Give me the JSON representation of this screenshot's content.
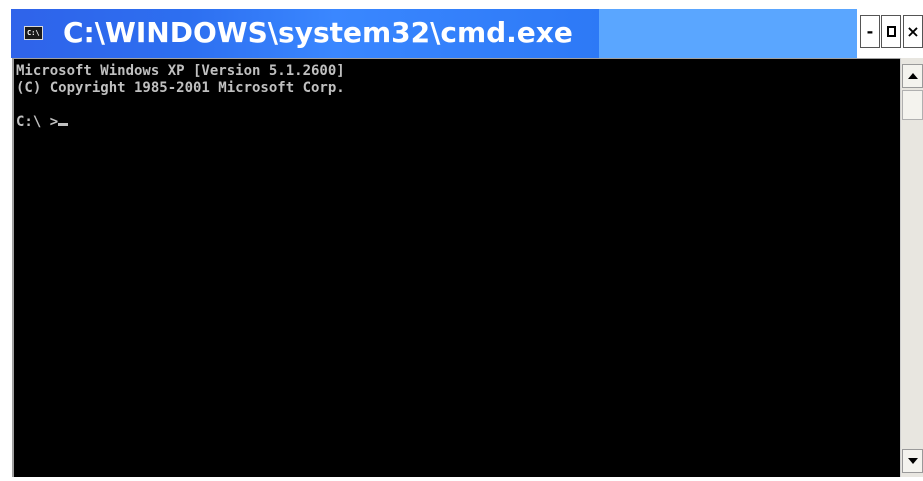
{
  "window": {
    "title": "C:\\WINDOWS\\system32\\cmd.exe",
    "icon_label": "C:\\",
    "controls": {
      "minimize": "-",
      "maximize": "maximize-box",
      "close": "×"
    }
  },
  "console": {
    "lines": [
      "Microsoft Windows XP [Version 5.1.2600]",
      "(C) Copyright 1985-2001 Microsoft Corp.",
      "",
      "C:\\ >"
    ]
  },
  "colors": {
    "title_blue": "#2f63ea",
    "title_lightblue": "#5aa6ff",
    "console_bg": "#000000",
    "console_fg": "#c0c0c0"
  }
}
